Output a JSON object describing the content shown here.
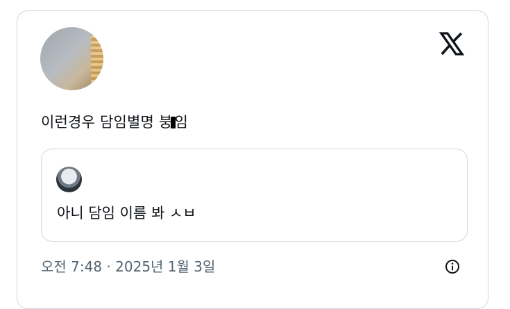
{
  "tweet": {
    "text_before": "이런경우 담임별명 붕",
    "text_after": "임",
    "quote": {
      "text": "아니 담임 이름 봐 ㅅㅂ"
    },
    "timestamp": "오전 7:48 · 2025년 1월 3일"
  },
  "icons": {
    "brand": "x-logo-icon",
    "info": "info-icon"
  },
  "colors": {
    "text": "#0f1419",
    "meta": "#536471",
    "border": "#cfd9de"
  }
}
